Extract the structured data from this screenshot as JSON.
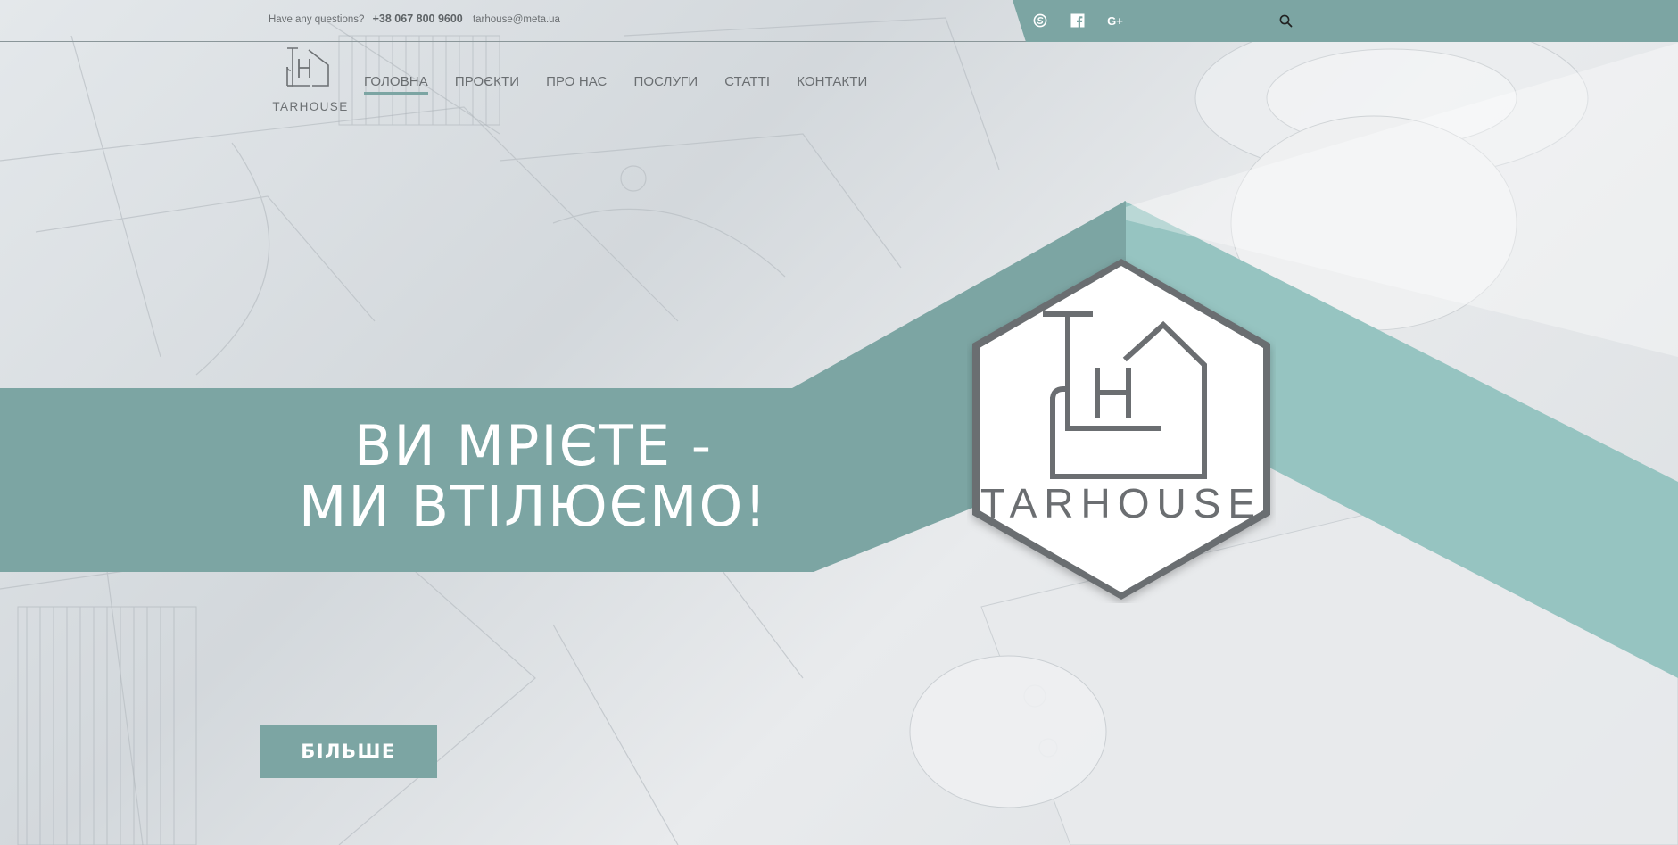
{
  "topbar": {
    "question": "Have any questions?",
    "phone": "+38 067 800 9600",
    "email": "tarhouse@meta.ua",
    "social": [
      {
        "name": "skype-icon"
      },
      {
        "name": "facebook-icon"
      },
      {
        "name": "google-plus-icon",
        "label": "G+"
      }
    ]
  },
  "brand": {
    "logo_text": "TARHOUSE",
    "logo_letter_t": "T",
    "logo_letter_h": "H"
  },
  "nav": {
    "items": [
      {
        "label": "ГОЛОВНА",
        "active": true
      },
      {
        "label": "ПРОЄКТИ",
        "active": false
      },
      {
        "label": "ПРО НАС",
        "active": false
      },
      {
        "label": "ПОСЛУГИ",
        "active": false
      },
      {
        "label": "СТАТТІ",
        "active": false
      },
      {
        "label": "КОНТАКТИ",
        "active": false
      }
    ]
  },
  "hero": {
    "headline_line1": "ВИ МРІЄТЕ -",
    "headline_line2": "МИ ВТІЛЮЄМО!",
    "button_label": "БІЛЬШЕ"
  },
  "colors": {
    "accent": "#7ca5a3",
    "accent_light": "#96c4c1",
    "text_gray": "#6a6e71"
  }
}
